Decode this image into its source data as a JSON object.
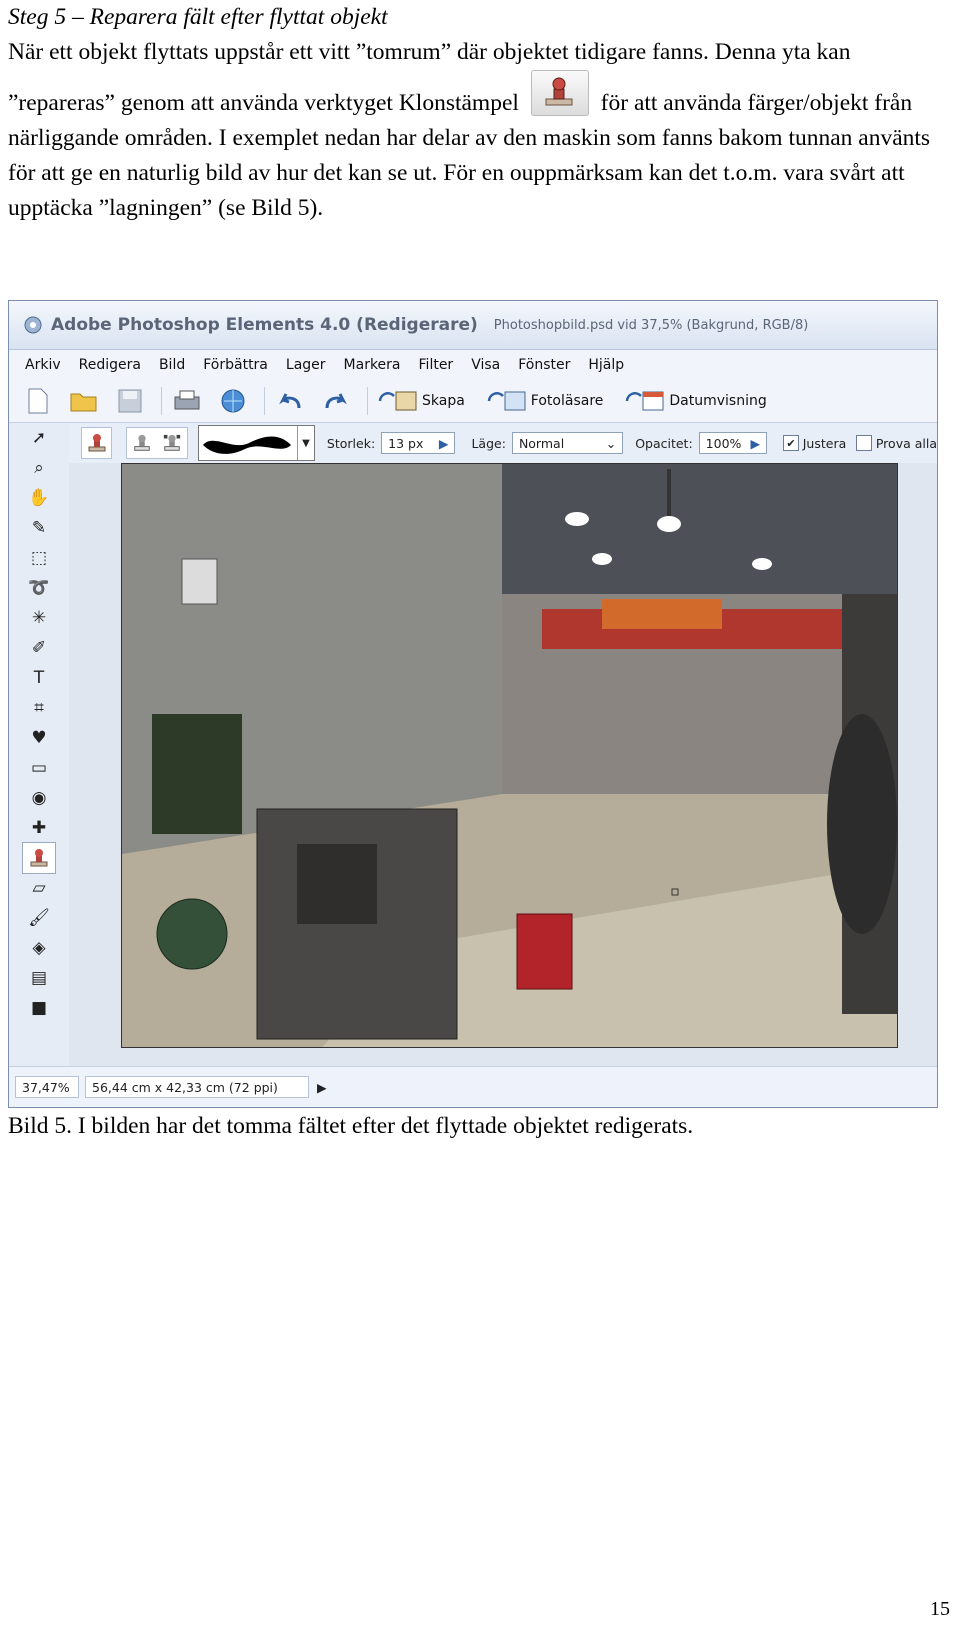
{
  "section": {
    "heading": "Steg 5 – Reparera fält efter flyttat objekt",
    "para_before_icon": "När ett objekt flyttats uppstår ett vitt ”tomrum” där objektet tidigare fanns. Denna yta kan ”repareras” genom att använda verktyget Klonstämpel",
    "para_after_icon": "för att använda färger/objekt från närliggande områden. I exemplet nedan har delar av den maskin som fanns bakom tunnan använts för att ge en naturlig bild av hur det kan se ut. För en ouppmärksam kan det t.o.m. vara svårt att upptäcka ”lagningen” (se Bild 5).",
    "inline_icon": "clone-stamp-icon"
  },
  "app": {
    "title": "Adobe Photoshop Elements 4.0 (Redigerare)",
    "document": "Photoshopbild.psd vid 37,5% (Bakgrund, RGB/8)",
    "menu": [
      "Arkiv",
      "Redigera",
      "Bild",
      "Förbättra",
      "Lager",
      "Markera",
      "Filter",
      "Visa",
      "Fönster",
      "Hjälp"
    ],
    "toolbar": {
      "create": "Skapa",
      "photo_browser": "Fotoläsare",
      "date_view": "Datumvisning"
    },
    "options": {
      "size_label": "Storlek:",
      "size_value": "13 px",
      "mode_label": "Läge:",
      "mode_value": "Normal",
      "opacity_label": "Opacitet:",
      "opacity_value": "100%",
      "align_label": "Justera",
      "align_checked": true,
      "sample_all_label": "Prova alla"
    },
    "status": {
      "zoom": "37,47%",
      "doc_size": "56,44 cm x 42,33 cm (72 ppi)"
    },
    "tools": [
      "move-tool-icon",
      "zoom-tool-icon",
      "hand-tool-icon",
      "eyedropper-tool-icon",
      "marquee-tool-icon",
      "lasso-tool-icon",
      "magic-wand-tool-icon",
      "selection-brush-icon",
      "type-tool-icon",
      "crop-tool-icon",
      "cookie-cutter-icon",
      "straighten-tool-icon",
      "red-eye-tool-icon",
      "healing-brush-icon",
      "clone-stamp-icon",
      "eraser-tool-icon",
      "brush-tool-icon",
      "paint-bucket-icon",
      "gradient-tool-icon",
      "shape-tool-icon"
    ]
  },
  "caption": "Bild 5. I bilden har det tomma fältet efter det flyttade objektet redigerats.",
  "page_number": "15"
}
